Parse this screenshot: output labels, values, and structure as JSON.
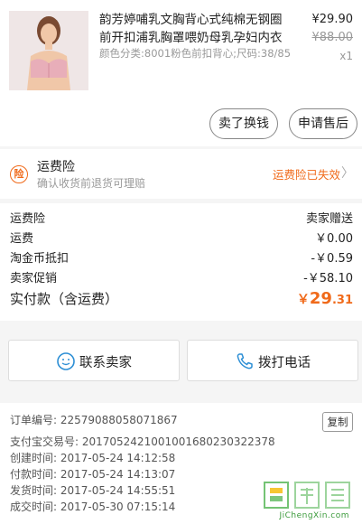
{
  "product": {
    "title": "韵芳婷哺乳文胸背心式纯棉无钢圈前开扣浦乳胸罩喂奶母乳孕妇内衣",
    "spec": "颜色分类:8001粉色前扣背心;尺码:38/85",
    "price": "¥29.90",
    "original_price": "¥88.00",
    "quantity": "x1",
    "buttons": {
      "exchange": "卖了换钱",
      "after_sale": "申请售后"
    }
  },
  "insurance": {
    "title": "运费险",
    "subtitle": "确认收货前退货可理赔",
    "status": "运费险已失效",
    "icon_char": "险",
    "chevron": "〉"
  },
  "fees": [
    {
      "label": "运费险",
      "value": "卖家赠送"
    },
    {
      "label": "运费",
      "value": "￥0.00"
    },
    {
      "label": "淘金币抵扣",
      "value": "-￥0.59"
    },
    {
      "label": "卖家促销",
      "value": "-￥58.10"
    }
  ],
  "total": {
    "label": "实付款（含运费）",
    "symbol": "￥",
    "integer": "29",
    "decimal": ".31"
  },
  "contact": {
    "seller_label": "联系卖家",
    "call_label": "拨打电话"
  },
  "order_info": {
    "order_no": "订单编号:  22579088058071867",
    "alipay_no": "支付宝交易号:  2017052421001001680230322378",
    "created": "创建时间:  2017-05-24 14:12:58",
    "paid": "付款时间:  2017-05-24 14:13:07",
    "shipped": "发货时间:  2017-05-24 14:55:51",
    "completed": "成交时间:  2017-05-30 07:15:14",
    "copy_label": "复制"
  },
  "watermark": {
    "chars": "集诚信",
    "domain": "JiChengXin.com"
  },
  "colors": {
    "accent": "#f06a1a",
    "text": "#222222",
    "muted": "#999999",
    "bg": "#f5f5f5"
  }
}
